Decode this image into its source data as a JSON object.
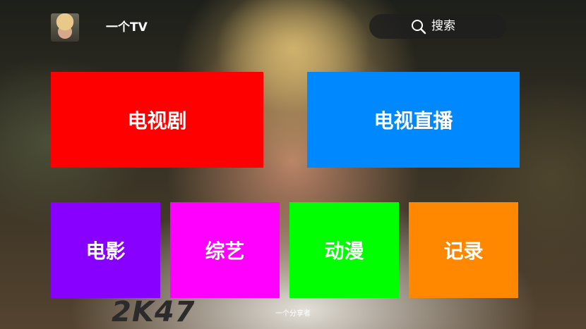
{
  "header": {
    "title": "一个TV",
    "avatar_icon": "user-avatar"
  },
  "search": {
    "label": "搜索",
    "icon": "search-icon"
  },
  "tiles": [
    {
      "label": "电视剧",
      "color": "#ff0000"
    },
    {
      "label": "电视直播",
      "color": "#0088ff"
    },
    {
      "label": "电影",
      "color": "#8800ff"
    },
    {
      "label": "综艺",
      "color": "#ff00ff"
    },
    {
      "label": "动漫",
      "color": "#00ff00"
    },
    {
      "label": "记录",
      "color": "#ff8800"
    }
  ],
  "background": {
    "shirt_text": "2K47"
  },
  "footer": {
    "credit": "一个分享者"
  }
}
